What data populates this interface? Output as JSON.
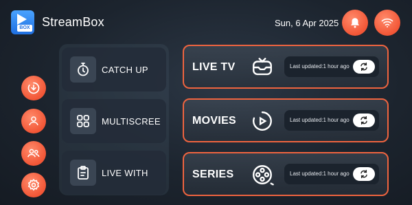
{
  "header": {
    "app_title": "StreamBox",
    "logo_badge": "BOX",
    "date": "Sun, 6 Apr 2025",
    "buttons": [
      "bell-icon",
      "wifi-icon"
    ],
    "accent": "#f25636"
  },
  "sidebar": {
    "buttons": [
      "download-icon",
      "user-icon",
      "users-icon",
      "settings-icon"
    ]
  },
  "menu": {
    "items": [
      {
        "label": "CATCH UP",
        "icon": "timer-icon"
      },
      {
        "label": "MULTISCREE",
        "icon": "grid-icon"
      },
      {
        "label": "LIVE WITH",
        "icon": "clipboard-icon"
      }
    ]
  },
  "cards": [
    {
      "title": "LIVE TV",
      "updated": "Last updated:1 hour ago",
      "icon": "tv-icon"
    },
    {
      "title": "MOVIES",
      "updated": "Last updated:1 hour ago",
      "icon": "movie-play-icon"
    },
    {
      "title": "SERIES",
      "updated": "Last updated:1 hour ago",
      "icon": "film-reel-icon"
    }
  ]
}
